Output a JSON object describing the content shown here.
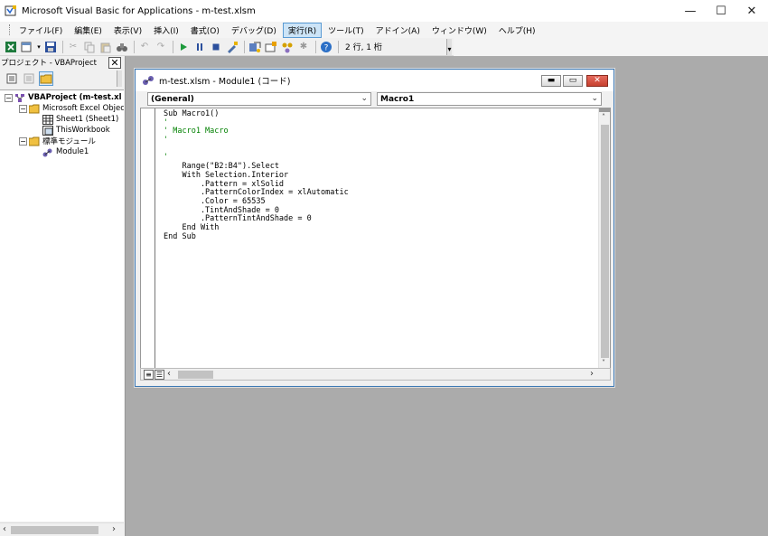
{
  "window": {
    "title": "Microsoft Visual Basic for Applications - m-test.xlsm",
    "min_glyph": "—",
    "max_glyph": "☐",
    "close_glyph": "✕"
  },
  "menu": {
    "items": [
      "ファイル(F)",
      "編集(E)",
      "表示(V)",
      "挿入(I)",
      "書式(O)",
      "デバッグ(D)",
      "実行(R)",
      "ツール(T)",
      "アドイン(A)",
      "ウィンドウ(W)",
      "ヘルプ(H)"
    ],
    "active_index": 6
  },
  "toolbar": {
    "position_label": "2 行, 1 桁"
  },
  "project_pane": {
    "title": "プロジェクト - VBAProject",
    "close_glyph": "✕",
    "tree": [
      {
        "label": "VBAProject (m-test.xl",
        "bold": true
      },
      {
        "label": "Microsoft Excel Objec",
        "bold": false
      },
      {
        "label": "Sheet1 (Sheet1)",
        "bold": false
      },
      {
        "label": "ThisWorkbook",
        "bold": false
      },
      {
        "label": "標準モジュール",
        "bold": false
      },
      {
        "label": "Module1",
        "bold": false
      }
    ],
    "expander_glyph": "−"
  },
  "code_window": {
    "title": "m-test.xlsm - Module1 (コード)",
    "object_combo": "(General)",
    "procedure_combo": "Macro1",
    "code_lines": [
      {
        "text": "Sub Macro1()",
        "comment": false
      },
      {
        "text": "'",
        "comment": true
      },
      {
        "text": "' Macro1 Macro",
        "comment": true
      },
      {
        "text": "'",
        "comment": true
      },
      {
        "text": "",
        "comment": false
      },
      {
        "text": "'",
        "comment": true
      },
      {
        "text": "    Range(\"B2:B4\").Select",
        "comment": false
      },
      {
        "text": "    With Selection.Interior",
        "comment": false
      },
      {
        "text": "        .Pattern = xlSolid",
        "comment": false
      },
      {
        "text": "        .PatternColorIndex = xlAutomatic",
        "comment": false
      },
      {
        "text": "        .Color = 65535",
        "comment": false
      },
      {
        "text": "        .TintAndShade = 0",
        "comment": false
      },
      {
        "text": "        .PatternTintAndShade = 0",
        "comment": false
      },
      {
        "text": "    End With",
        "comment": false
      },
      {
        "text": "End Sub",
        "comment": false
      }
    ]
  },
  "colors": {
    "accent": "#5a9bd4",
    "comment": "#008000",
    "workspace": "#ababab"
  }
}
